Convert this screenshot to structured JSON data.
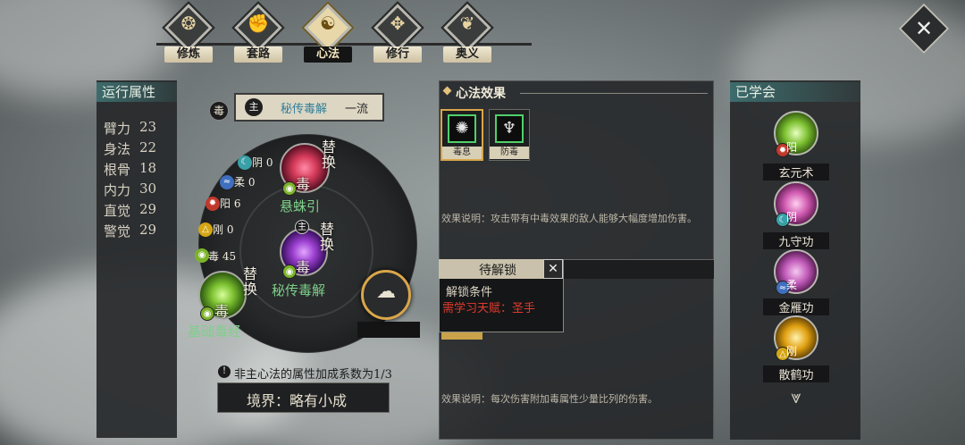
{
  "tabs": [
    {
      "label": "修炼",
      "active": false
    },
    {
      "label": "套路",
      "active": false
    },
    {
      "label": "心法",
      "active": true
    },
    {
      "label": "修行",
      "active": false
    },
    {
      "label": "奥义",
      "active": false
    }
  ],
  "left_panel": {
    "title": "运行属性",
    "stats": [
      {
        "name": "臂力",
        "value": "23"
      },
      {
        "name": "身法",
        "value": "22"
      },
      {
        "name": "根骨",
        "value": "18"
      },
      {
        "name": "内力",
        "value": "30"
      },
      {
        "name": "直觉",
        "value": "29"
      },
      {
        "name": "警觉",
        "value": "29"
      }
    ]
  },
  "center": {
    "main_badge": "毒",
    "main_marker": "主",
    "main_name": "秘传毒解",
    "main_grade": "一流",
    "attributes": [
      {
        "glyph": "☾",
        "name": "阴",
        "value": "0",
        "color": "#3aa0a8"
      },
      {
        "glyph": "≈",
        "name": "柔",
        "value": "0",
        "color": "#3f6fbf"
      },
      {
        "glyph": "✹",
        "name": "阳",
        "value": "6",
        "color": "#c0392b"
      },
      {
        "glyph": "△",
        "name": "刚",
        "value": "0",
        "color": "#d4a514"
      },
      {
        "glyph": "◉",
        "name": "毒",
        "value": "45",
        "color": "#7cb32a"
      }
    ],
    "slots": [
      {
        "name": "悬蛛引",
        "element": "毒",
        "swap": "替换",
        "color": "#d63b5a"
      },
      {
        "name": "秘传毒解",
        "element": "毒",
        "swap": "替换",
        "marker": "主",
        "color": "#9b3fd0"
      },
      {
        "name": "基础毒经",
        "element": "毒",
        "swap": "替换",
        "color": "#7cc030"
      }
    ],
    "note": "非主心法的属性加成系数为1/3",
    "realm": "境界：略有小成"
  },
  "effects": {
    "title": "心法效果",
    "items": [
      {
        "label": "毒息"
      },
      {
        "label": "防毒"
      }
    ],
    "desc1": "效果说明：攻击带有中毒效果的敌人能够大幅度增加伤害。",
    "desc2": "效果说明：每次伤害附加毒属性少量比列的伤害。",
    "popup": {
      "title": "待解锁",
      "cond_label": "解锁条件",
      "cond": "需学习天赋：圣手"
    }
  },
  "learned": {
    "title": "已学会",
    "items": [
      {
        "name": "玄元术",
        "element": "阳",
        "color": "#7cc030"
      },
      {
        "name": "九守功",
        "element": "阴",
        "color": "#d05ab0"
      },
      {
        "name": "金雁功",
        "element": "柔",
        "color": "#c05ab8"
      },
      {
        "name": "散鹤功",
        "element": "刚",
        "color": "#e0a010"
      }
    ]
  },
  "colors": {
    "gold": "#e2c27a",
    "panel": "#27292b"
  }
}
